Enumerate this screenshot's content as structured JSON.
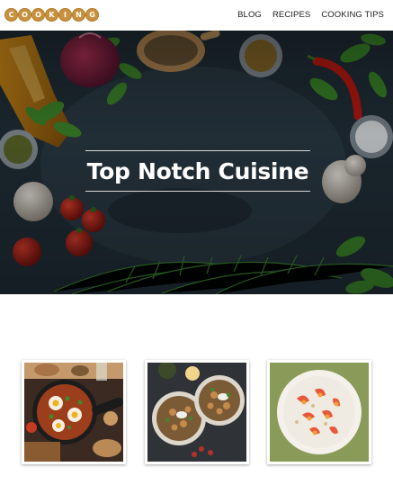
{
  "header": {
    "logo_letters": [
      "C",
      "O",
      "O",
      "K",
      "I",
      "N",
      "G"
    ],
    "nav": [
      {
        "label": "BLOG"
      },
      {
        "label": "RECIPES"
      },
      {
        "label": "COOKING TIPS"
      }
    ]
  },
  "hero": {
    "title": "Top Notch Cuisine"
  },
  "gallery": {
    "items": [
      {
        "icon": "shakshuka-pan-photo"
      },
      {
        "icon": "chicken-bowls-photo"
      },
      {
        "icon": "shrimp-plate-photo"
      }
    ]
  },
  "colors": {
    "brand": "#c8913e",
    "hero_dark": "#1f2a33",
    "nav_text": "#222222"
  }
}
